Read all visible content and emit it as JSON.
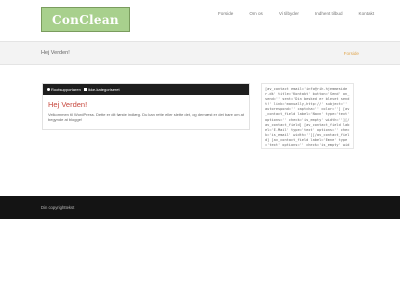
{
  "header": {
    "logo_text": "ConClean",
    "nav": [
      "Forside",
      "Om os",
      "Vi tilbyder",
      "Indhent tilbud",
      "Kontakt"
    ]
  },
  "title_bar": {
    "heading": "Hej Verden!",
    "breadcrumb": "Forside"
  },
  "post": {
    "author": "Rootsupportaren",
    "category": "Ikke-kategoriseret",
    "title": "Hej Verden!",
    "body": "Velkommen til WordPress. Dette er dit første indlæg. Du kan rette eller slette det, og dernæst er det bare om at begynde at blogge!"
  },
  "sidebar": {
    "text": "[av_contact email='info@rih-hjemmesider.dk' title='Kontakt' button='Send' on_send='' sent='Din besked er blevet sendt!' link='manually,http://' subject='' autorespond='' captcha='' color=''] [av_contact_field label='Navn' type='text' options='' check='is_empty' width=''][/av_contact_field] [av_contact_field label='E-Mail' type='text' options='' check='is_email' width=''][/av_contact_field] [av_contact_field label='Emne' type='text' options='' check='is_empty' width=''][/av_contact_field] [av_contact_field label='Meddelelse' type='textarea' options='' check='is_empty' width=''][/av_contact_field] [/av_contact]"
  },
  "footer": {
    "copyright": "Din copyrighttekst"
  },
  "colors": {
    "logo_bg": "#a8d08d",
    "accent_red": "#c7473d",
    "breadcrumb": "#e0a64f",
    "footer_bg": "#141414"
  }
}
